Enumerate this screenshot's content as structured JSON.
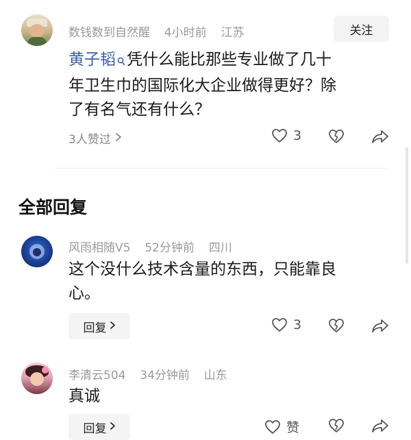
{
  "post": {
    "username": "数钱数到自然醒",
    "time": "4小时前",
    "location": "江苏",
    "follow_label": "关注",
    "mention": "黄子韬",
    "text": "凭什么能比那些专业做了几十",
    "text_line2": "年卫生巾的国际化大企业做得更好？除",
    "text_line3": "了有名气还有什么？",
    "likes_summary": "3人赞过",
    "like_count": "3"
  },
  "section_title": "全部回复",
  "replies": [
    {
      "username": "风雨相随V5",
      "time": "52分钟前",
      "location": "四川",
      "line1": "这个没什么技术含量的东西，只能靠良",
      "line2": "心。",
      "reply_label": "回复",
      "like_count": "3"
    },
    {
      "username": "李清云504",
      "time": "34分钟前",
      "location": "山东",
      "line1": "真诚",
      "reply_label": "回复",
      "like_label": "赞"
    }
  ],
  "icons": {
    "like": "heart-outline-icon",
    "dislike": "broken-heart-icon",
    "share": "share-arrow-icon",
    "chevron": "chevron-right-icon",
    "search": "search-small-icon"
  },
  "colors": {
    "mention": "#3a5fa8",
    "meta": "#9a9a9a"
  }
}
